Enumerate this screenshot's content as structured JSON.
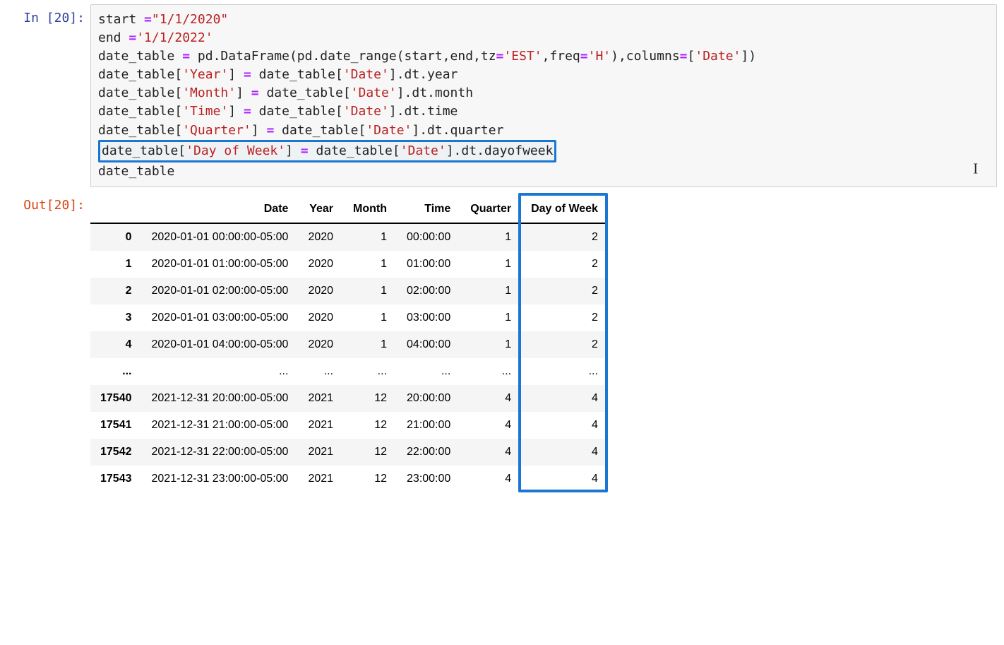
{
  "input_prompt": "In [20]:",
  "output_prompt": "Out[20]:",
  "code": {
    "l1": {
      "t1": "start ",
      "op": "=",
      "s1": "\"1/1/2020\""
    },
    "l2": {
      "t1": "end ",
      "op": "=",
      "s1": "'1/1/2022'"
    },
    "l3": {
      "t1": "date_table ",
      "op": "=",
      "t2": " pd.DataFrame(pd.date_range(start,end,tz",
      "op2": "=",
      "s1": "'EST'",
      "t3": ",freq",
      "op3": "=",
      "s2": "'H'",
      "t4": "),columns",
      "op4": "=",
      "t5": "[",
      "s3": "'Date'",
      "t6": "])"
    },
    "l4": {
      "t1": "date_table[",
      "s1": "'Year'",
      "t2": "] ",
      "op": "=",
      "t3": " date_table[",
      "s2": "'Date'",
      "t4": "].dt.year"
    },
    "l5": {
      "t1": "date_table[",
      "s1": "'Month'",
      "t2": "] ",
      "op": "=",
      "t3": " date_table[",
      "s2": "'Date'",
      "t4": "].dt.month"
    },
    "l6": {
      "t1": "date_table[",
      "s1": "'Time'",
      "t2": "] ",
      "op": "=",
      "t3": " date_table[",
      "s2": "'Date'",
      "t4": "].dt.time"
    },
    "l7": {
      "t1": "date_table[",
      "s1": "'Quarter'",
      "t2": "] ",
      "op": "=",
      "t3": " date_table[",
      "s2": "'Date'",
      "t4": "].dt.quarter"
    },
    "l8": {
      "t1": "date_table[",
      "s1": "'Day of Week'",
      "t2": "] ",
      "op": "=",
      "t3": " date_table[",
      "s2": "'Date'",
      "t4": "].dt.dayofweek"
    },
    "l9": {
      "t1": "date_table"
    }
  },
  "table": {
    "headers": [
      "",
      "Date",
      "Year",
      "Month",
      "Time",
      "Quarter",
      "Day of Week"
    ],
    "rows": [
      {
        "idx": "0",
        "cells": [
          "2020-01-01 00:00:00-05:00",
          "2020",
          "1",
          "00:00:00",
          "1",
          "2"
        ]
      },
      {
        "idx": "1",
        "cells": [
          "2020-01-01 01:00:00-05:00",
          "2020",
          "1",
          "01:00:00",
          "1",
          "2"
        ]
      },
      {
        "idx": "2",
        "cells": [
          "2020-01-01 02:00:00-05:00",
          "2020",
          "1",
          "02:00:00",
          "1",
          "2"
        ]
      },
      {
        "idx": "3",
        "cells": [
          "2020-01-01 03:00:00-05:00",
          "2020",
          "1",
          "03:00:00",
          "1",
          "2"
        ]
      },
      {
        "idx": "4",
        "cells": [
          "2020-01-01 04:00:00-05:00",
          "2020",
          "1",
          "04:00:00",
          "1",
          "2"
        ]
      },
      {
        "idx": "...",
        "cells": [
          "...",
          "...",
          "...",
          "...",
          "...",
          "..."
        ]
      },
      {
        "idx": "17540",
        "cells": [
          "2021-12-31 20:00:00-05:00",
          "2021",
          "12",
          "20:00:00",
          "4",
          "4"
        ]
      },
      {
        "idx": "17541",
        "cells": [
          "2021-12-31 21:00:00-05:00",
          "2021",
          "12",
          "21:00:00",
          "4",
          "4"
        ]
      },
      {
        "idx": "17542",
        "cells": [
          "2021-12-31 22:00:00-05:00",
          "2021",
          "12",
          "22:00:00",
          "4",
          "4"
        ]
      },
      {
        "idx": "17543",
        "cells": [
          "2021-12-31 23:00:00-05:00",
          "2021",
          "12",
          "23:00:00",
          "4",
          "4"
        ]
      }
    ]
  },
  "colors": {
    "in_prompt": "#303F9F",
    "out_prompt": "#D84315",
    "highlight_border": "#1976D2",
    "string": "#BA2121",
    "operator": "#AA22FF"
  }
}
